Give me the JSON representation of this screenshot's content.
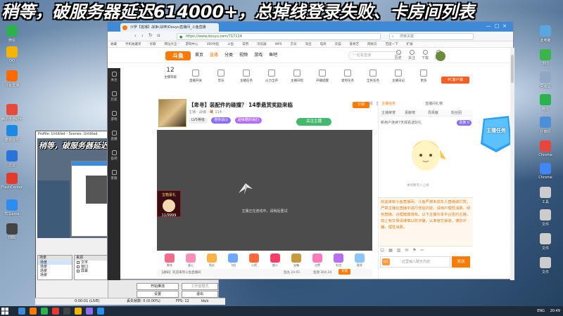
{
  "overlay": {
    "text": "稍等，破服务器延迟614000+，总掉线登录失败、卡房间列表"
  },
  "desktop_icons_left": [
    {
      "label": "微信",
      "color": "#2bb24c"
    },
    {
      "label": "QQ",
      "color": "#f5b400"
    },
    {
      "label": "斗鱼直播",
      "color": "#ff6a00"
    },
    {
      "label": "腾讯手游助手",
      "color": "#e64a3b"
    },
    {
      "label": "酷狗音乐",
      "color": "#1e88e5"
    },
    {
      "label": "迅雷",
      "color": "#2a73d8"
    },
    {
      "label": "FlashCenter",
      "color": "#e23b2e"
    },
    {
      "label": "TCGame",
      "color": "#2d8cf0"
    },
    {
      "label": "OBS",
      "color": "#444444"
    }
  ],
  "desktop_icons_right": [
    {
      "label": "此电脑",
      "color": "#5aa7e0"
    },
    {
      "label": "360",
      "color": "#39b54a"
    },
    {
      "label": "回收站",
      "color": "#8fa9c4"
    },
    {
      "label": "微信",
      "color": "#2bb24c"
    },
    {
      "label": "计算机",
      "color": "#4a90d9"
    },
    {
      "label": "Chrome",
      "color": "#e8453c"
    },
    {
      "label": "Chrome",
      "color": "#4285f4"
    },
    {
      "label": "工具",
      "color": "#cccccc"
    },
    {
      "label": "文件",
      "color": "#cccccc"
    },
    {
      "label": "文件",
      "color": "#cccccc"
    },
    {
      "label": "文件",
      "color": "#cccccc"
    }
  ],
  "obs": {
    "title": "Profile: Untitled - Scenes: Untitled",
    "preview_text": "稍等，破服务器延迟61",
    "scenes_header": "场景",
    "scenes": [
      "场景",
      "场景",
      "场景",
      "场景"
    ],
    "sources_header": "来源",
    "sources": [
      "文字",
      "窗口",
      "屏幕"
    ],
    "buttons": {
      "start_stream": "开始推流",
      "settings": "设置",
      "exit": "退出",
      "studio_mode": "工作室模式"
    },
    "status": {
      "time": "0:00:01 (LIVE)",
      "dropped": "丢失帧数: 0 (0.00%)",
      "fps": "FPS: 12",
      "kbps": "kb/s"
    }
  },
  "browser": {
    "tab_title": "沙罗【首播】战争(战神)Douyu直播间_斗鱼直播",
    "url": "https://www.douyu.com/717114",
    "search_placeholder": "搜索关键",
    "bookmarks": [
      "收藏",
      "手机收藏夹",
      "谷歌",
      "网址大全",
      "游戏中心",
      "360导航",
      "斗鱼",
      "常用",
      "浏览器",
      "WPS",
      "京东",
      "淘宝",
      "电商",
      "天猫",
      "爱奇艺",
      "网易云",
      "百度一下",
      "扩展"
    ]
  },
  "douyu": {
    "logo": "斗鱼",
    "nav": [
      "首页",
      "直播",
      "分类",
      "视频",
      "游戏",
      "鱼吧"
    ],
    "search_placeholder": "一起看直播",
    "user_items": [
      "历史",
      "关注",
      "下载",
      "消息"
    ],
    "categories": [
      {
        "label": "主播等级",
        "num": "12"
      },
      {
        "label": "直播开关"
      },
      {
        "label": "音乐"
      },
      {
        "label": "主播任务"
      },
      {
        "label": "火力全开"
      },
      {
        "label": "主播日程"
      },
      {
        "label": "开播提醒"
      },
      {
        "label": "星际任务"
      },
      {
        "label": "全民任务"
      },
      {
        "label": "主播日记"
      },
      {
        "label": "更多"
      }
    ],
    "pc_client": "PC客户端",
    "sidebar": [
      "关注",
      "历史",
      "游戏",
      "直播",
      "鱼吧",
      "客服"
    ],
    "room": {
      "title": "【卑寻】装配件的碰撞？ 14季悬赏奖励来临",
      "meta": "主播 · 战魂 · 💐 114",
      "tag_lv": "LV5等级",
      "tag_1": "陪你战斗",
      "tag_2": "超级酷的哥们",
      "follow": "关注主播",
      "right_info": "分享 · 举报 · 直播中",
      "subscribe": "订阅"
    },
    "video": {
      "loading_text": "主播正在连线中，请稍后重试"
    },
    "treasure": {
      "title": "宝箱豪礼",
      "count": "11/9999"
    },
    "gifts": [
      "鲜花",
      "爱心",
      "鱼丸",
      "飞机",
      "火箭",
      "超火",
      "宝箱",
      "点赞",
      "礼包",
      "更多"
    ],
    "bottom": {
      "left": "【通知】欢迎来到斗鱼直播间",
      "balance_1": "鱼丸 24:01",
      "balance_2": "鱼翅 304.24",
      "pay": "充值"
    },
    "right_panel": {
      "tabs1": [
        "主播任务",
        "直播间礼物"
      ],
      "tabs2": [
        "主播荣誉",
        "贡献榜",
        "周贡献",
        "粉丝团"
      ],
      "rank_text": "新用户连续7天观看送好礼",
      "vip": "贵族 0",
      "mascot_text": "本场暂无人上榜",
      "notice": "欢迎来到斗鱼直播间，斗鱼严禁未成年人直播或打赏。严禁主播在直播中进行低俗内容。请用户理性消费，绿色直播，合理健康游戏。以下主播为本平台签约主播，如上有交易请谨慎以防诈骗，认准官方渠道，谨防诈骗，理性消费。",
      "tools": "☺ ▦ ▥ ✉ ⚑ ✂",
      "input_level": "LV1",
      "input_placeholder": "这里输入聊天内容",
      "send": "发送"
    },
    "promo": "主播任务"
  },
  "taskbar": {
    "lang": "ENG",
    "time": "20:49"
  }
}
